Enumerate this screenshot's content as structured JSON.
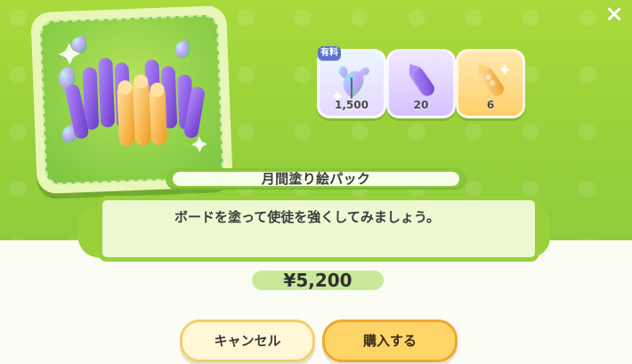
{
  "dialog": {
    "close_icon": "×",
    "title": "月間塗り絵パック",
    "description": "ボードを塗って使徒を強くしてみましょう。",
    "price": "¥5,200",
    "buttons": {
      "cancel_label": "キャンセル",
      "buy_label": "購入する"
    },
    "items": [
      {
        "icon": "rainbow-leaf-icon",
        "badge": "有料",
        "quantity": "1,500"
      },
      {
        "icon": "purple-crayon-icon",
        "quantity": "20"
      },
      {
        "icon": "orange-crayon-icon",
        "quantity": "6"
      }
    ]
  },
  "colors": {
    "background_green": "#98d13a",
    "panel_light_green": "#edf9d3",
    "accent_orange": "#ffd56a",
    "paid_badge_blue": "#5a73d1"
  }
}
